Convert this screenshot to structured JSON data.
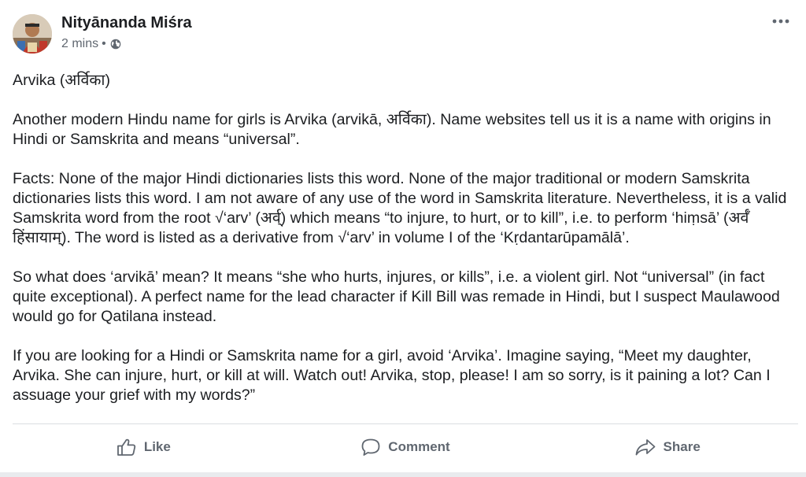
{
  "post": {
    "author": "Nityānanda Miśra",
    "time": "2 mins",
    "separator": "•",
    "privacy_icon": "globe-icon",
    "more_icon": "more-horizontal-icon",
    "paragraphs": [
      "Arvika (अर्विका)",
      "Another modern Hindu name for girls is Arvika (arvikā, अर्विका). Name websites tell us it is a name with origins in Hindi or Samskrita and means “universal”.",
      "Facts: None of the major Hindi dictionaries lists this word. None of the major traditional or modern Samskrita dictionaries lists this word. I am not aware of any use of the word in Samskrita literature. Nevertheless, it is a valid Samskrita word from the root √‘arv’ (अर्व्) which means “to injure, to hurt, or to kill”, i.e. to perform ‘hiṃsā’ (अर्वँ हिंसायाम्). The word is listed as a derivative from √‘arv’ in volume I of the ‘Kṛdantarūpamālā’.",
      "So what does ‘arvikā’ mean? It means “she who hurts, injures, or kills”, i.e. a violent girl. Not “universal” (in fact quite exceptional). A perfect name for the lead character if Kill Bill was remade in Hindi, but I suspect Maulawood would go for Qatilana instead.",
      "If you are looking for a Hindi or Samskrita name for a girl, avoid ‘Arvika’. Imagine saying, “Meet my daughter, Arvika. She can injure, hurt, or kill at will. Watch out! Arvika, stop, please! I am so sorry, is it paining a lot? Can I assuage your grief with my words?”"
    ]
  },
  "actions": {
    "like": "Like",
    "comment": "Comment",
    "share": "Share"
  },
  "colors": {
    "text": "#1c1e21",
    "secondary": "#606770",
    "divider": "#dadde1"
  }
}
